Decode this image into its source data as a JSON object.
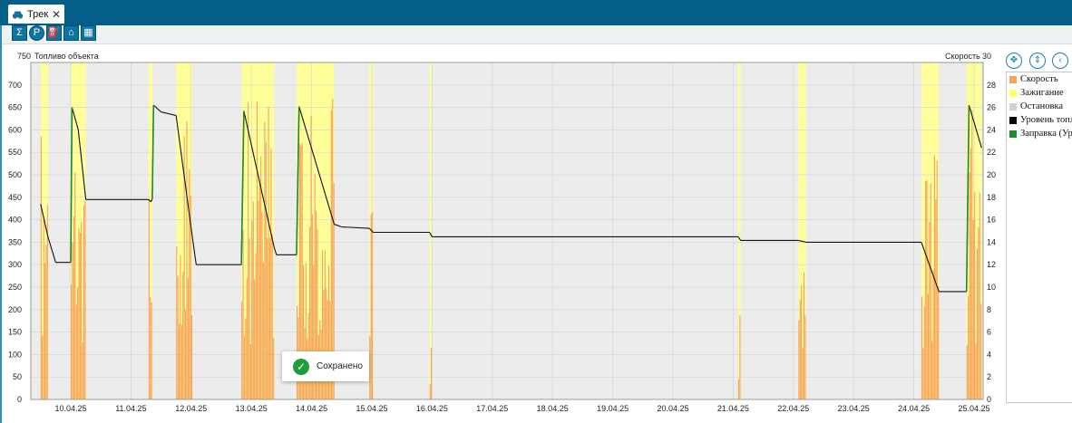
{
  "tab": {
    "label": "Трек",
    "close": "✕"
  },
  "toolbar": {
    "buttons": [
      "Σ",
      "P",
      "⛽",
      "⌂",
      "▦"
    ]
  },
  "axes": {
    "left_title_value": "750",
    "left_title": "Топливо объекта",
    "right_title": "Скорость",
    "right_title_value": "30"
  },
  "legend": {
    "items": [
      {
        "label": "Скорость",
        "color": "#f6a35c"
      },
      {
        "label": "Зажигание",
        "color": "#ffff66"
      },
      {
        "label": "Остановка",
        "color": "#d3d3d3"
      },
      {
        "label": "Уровень топливa",
        "color": "#000000"
      },
      {
        "label": "Заправка (Уровень)",
        "color": "#1e8c2c"
      }
    ]
  },
  "toast": {
    "text": "Сохранено"
  },
  "chart_data": {
    "type": "line",
    "x_start": "09.04.25 12:00",
    "x_ticks": [
      "10.04.25",
      "11.04.25",
      "12.04.25",
      "13.04.25",
      "14.04.25",
      "15.04.25",
      "16.04.25",
      "17.04.25",
      "18.04.25",
      "19.04.25",
      "20.04.25",
      "21.04.25",
      "22.04.25",
      "23.04.25",
      "24.04.25",
      "25.04.25"
    ],
    "ylim_left": [
      0,
      750
    ],
    "yticks_left": [
      0,
      50,
      100,
      150,
      200,
      250,
      300,
      350,
      400,
      450,
      500,
      550,
      600,
      650,
      700
    ],
    "ylim_right": [
      0,
      30
    ],
    "yticks_right": [
      0,
      2,
      4,
      6,
      8,
      10,
      12,
      14,
      16,
      18,
      20,
      22,
      24,
      26,
      28
    ],
    "grid": true,
    "colors": {
      "speed": "#f6a35c",
      "ignition": "#ffff99",
      "fuel": "#111111",
      "refuel": "#1e8c2c",
      "plot_bg": "#ececec"
    },
    "ignition_periods": [
      [
        "09.04.25 12:00",
        "09.04.25 15:00"
      ],
      [
        "10.04.25 00:00",
        "10.04.25 06:00"
      ],
      [
        "11.04.25 07:00",
        "11.04.25 08:30"
      ],
      [
        "11.04.25 18:00",
        "12.04.25 00:30"
      ],
      [
        "12.04.25 20:00",
        "13.04.25 09:00"
      ],
      [
        "13.04.25 18:00",
        "14.04.25 09:00"
      ],
      [
        "14.04.25 23:00",
        "15.04.25 00:30"
      ],
      [
        "15.04.25 23:00",
        "16.04.25 00:00"
      ],
      [
        "21.04.25 02:00",
        "21.04.25 03:00"
      ],
      [
        "22.04.25 02:00",
        "22.04.25 05:00"
      ],
      [
        "24.04.25 03:00",
        "24.04.25 10:00"
      ],
      [
        "24.04.25 21:00",
        "25.04.25 03:00"
      ]
    ],
    "speed_bursts": [
      {
        "start": "09.04.25 12:00",
        "end": "09.04.25 15:00",
        "max": 25
      },
      {
        "start": "10.04.25 00:00",
        "end": "10.04.25 06:00",
        "max": 26
      },
      {
        "start": "11.04.25 07:00",
        "end": "11.04.25 08:30",
        "max": 19
      },
      {
        "start": "11.04.25 18:00",
        "end": "12.04.25 00:30",
        "max": 26
      },
      {
        "start": "12.04.25 20:00",
        "end": "13.04.25 09:00",
        "max": 27
      },
      {
        "start": "13.04.25 18:00",
        "end": "14.04.25 09:00",
        "max": 27
      },
      {
        "start": "14.04.25 23:00",
        "end": "15.04.25 00:30",
        "max": 17
      },
      {
        "start": "15.04.25 23:00",
        "end": "16.04.25 00:00",
        "max": 5
      },
      {
        "start": "21.04.25 02:00",
        "end": "21.04.25 03:00",
        "max": 9
      },
      {
        "start": "22.04.25 02:00",
        "end": "22.04.25 05:00",
        "max": 17
      },
      {
        "start": "24.04.25 03:00",
        "end": "24.04.25 10:00",
        "max": 25
      },
      {
        "start": "24.04.25 21:00",
        "end": "25.04.25 03:00",
        "max": 26
      }
    ],
    "series": [
      {
        "name": "Уровень топлива",
        "points": [
          [
            "09.04.25 12:00",
            435
          ],
          [
            "09.04.25 15:00",
            360
          ],
          [
            "09.04.25 18:00",
            305
          ],
          [
            "10.04.25 00:00",
            305
          ],
          [
            "10.04.25 00:30",
            650
          ],
          [
            "10.04.25 03:00",
            600
          ],
          [
            "10.04.25 06:00",
            445
          ],
          [
            "11.04.25 07:00",
            445
          ],
          [
            "11.04.25 08:00",
            440
          ],
          [
            "11.04.25 08:30",
            447
          ],
          [
            "11.04.25 09:00",
            655
          ],
          [
            "11.04.25 12:00",
            640
          ],
          [
            "11.04.25 18:00",
            632
          ],
          [
            "12.04.25 00:30",
            360
          ],
          [
            "12.04.25 02:00",
            300
          ],
          [
            "12.04.25 20:00",
            300
          ],
          [
            "12.04.25 21:00",
            642
          ],
          [
            "13.04.25 09:00",
            340
          ],
          [
            "13.04.25 10:00",
            322
          ],
          [
            "13.04.25 18:00",
            322
          ],
          [
            "13.04.25 19:00",
            652
          ],
          [
            "14.04.25 09:00",
            390
          ],
          [
            "14.04.25 12:00",
            384
          ],
          [
            "14.04.25 23:00",
            381
          ],
          [
            "15.04.25 00:30",
            372
          ],
          [
            "15.04.25 23:00",
            372
          ],
          [
            "16.04.25 00:00",
            362
          ],
          [
            "21.04.25 02:00",
            362
          ],
          [
            "21.04.25 03:00",
            354
          ],
          [
            "22.04.25 02:00",
            354
          ],
          [
            "22.04.25 05:00",
            350
          ],
          [
            "24.04.25 03:00",
            350
          ],
          [
            "24.04.25 10:00",
            240
          ],
          [
            "24.04.25 21:00",
            240
          ],
          [
            "24.04.25 22:00",
            655
          ],
          [
            "25.04.25 03:00",
            560
          ]
        ]
      },
      {
        "name": "Заправка (Уровень)",
        "segments": [
          [
            [
              "10.04.25 00:00",
              305
            ],
            [
              "10.04.25 00:30",
              650
            ]
          ],
          [
            [
              "11.04.25 08:30",
              447
            ],
            [
              "11.04.25 09:00",
              655
            ]
          ],
          [
            [
              "12.04.25 20:00",
              300
            ],
            [
              "12.04.25 21:00",
              642
            ]
          ],
          [
            [
              "13.04.25 18:00",
              322
            ],
            [
              "13.04.25 19:00",
              652
            ]
          ],
          [
            [
              "24.04.25 21:00",
              240
            ],
            [
              "24.04.25 22:00",
              655
            ]
          ]
        ]
      }
    ]
  }
}
